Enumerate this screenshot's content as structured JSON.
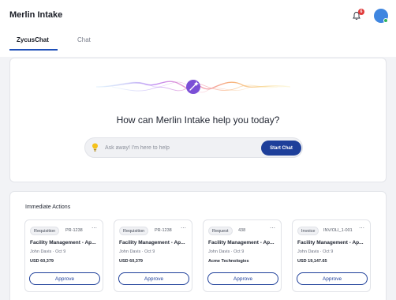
{
  "app": {
    "title": "Merlin Intake"
  },
  "header": {
    "notification_count": "6"
  },
  "tabs": [
    {
      "label": "ZycusChat",
      "active": true
    },
    {
      "label": "Chat",
      "active": false
    }
  ],
  "hero": {
    "heading": "How can Merlin Intake help you today?",
    "input_placeholder": "Ask away! I'm here to help",
    "input_value": "",
    "start_button": "Start Chat"
  },
  "immediate_actions": {
    "title": "Immediate Actions",
    "cards": [
      {
        "type": "Requisition",
        "id": "PR-1238",
        "title": "Facility Management - Ap...",
        "requester": "John Davis",
        "date": "Oct 9",
        "value": "USD 60,379",
        "action": "Approve"
      },
      {
        "type": "Requisition",
        "id": "PR-1238",
        "title": "Facility Management - Ap...",
        "requester": "John Davis",
        "date": "Oct 9",
        "value": "USD 60,379",
        "action": "Approve"
      },
      {
        "type": "Request",
        "id": "438",
        "title": "Facility Management - Ap...",
        "requester": "John Davis",
        "date": "Oct 9",
        "value": "Acme Technologies",
        "action": "Approve"
      },
      {
        "type": "Invoice",
        "id": "INV/OLI_1-001",
        "title": "Facility Management - Ap...",
        "requester": "John Davis",
        "date": "Oct 9",
        "value": "USD 19,147.65",
        "action": "Approve"
      }
    ]
  },
  "icons": {
    "notification": "bell-icon",
    "assistant": "magic-wand-icon",
    "prompt": "lightbulb-icon",
    "card_menu": "more-icon"
  },
  "colors": {
    "primary": "#1e3f9a",
    "accent": "#1e4fb8",
    "badge": "#e03a3a",
    "avatar": "#3f86e0",
    "status": "#2fb15a"
  }
}
